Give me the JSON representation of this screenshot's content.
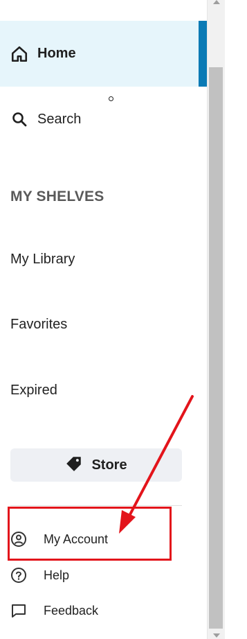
{
  "nav": {
    "home_label": "Home",
    "search_label": "Search"
  },
  "shelves": {
    "title": "MY SHELVES",
    "items": [
      "My Library",
      "Favorites",
      "Expired"
    ]
  },
  "store": {
    "label": "Store"
  },
  "footer": {
    "items": [
      {
        "label": "My Account",
        "icon": "account-circle-icon"
      },
      {
        "label": "Help",
        "icon": "help-circle-icon"
      },
      {
        "label": "Feedback",
        "icon": "feedback-chat-icon"
      }
    ]
  },
  "colors": {
    "accent": "#0a7ab5",
    "home_bg": "#e6f5fb",
    "annotation": "#e3141b"
  }
}
